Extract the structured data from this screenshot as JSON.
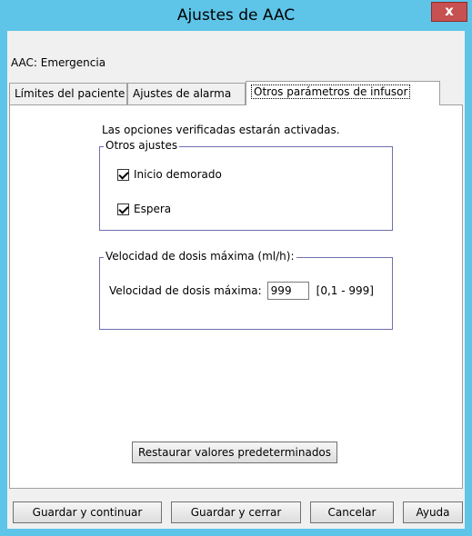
{
  "window": {
    "title": "Ajustes de AAC",
    "close_label": "x"
  },
  "context_label": "AAC: Emergencia",
  "tabs": [
    {
      "label": "Límites del paciente"
    },
    {
      "label": "Ajustes de alarma"
    },
    {
      "label": "Otros parámetros de infusor"
    }
  ],
  "active_tab_index": 2,
  "panel": {
    "note": "Las opciones verificadas estarán activadas.",
    "otros_ajustes": {
      "legend": "Otros ajustes",
      "options": [
        {
          "label": "Inicio demorado",
          "checked": true
        },
        {
          "label": "Espera",
          "checked": true
        }
      ]
    },
    "velocidad": {
      "legend": "Velocidad de dosis máxima (ml/h):",
      "field_label": "Velocidad de dosis máxima:",
      "value": "999",
      "range": "[0,1 - 999]"
    },
    "restore_button": "Restaurar valores predeterminados"
  },
  "footer": {
    "save_continue": "Guardar y continuar",
    "save_close": "Guardar y cerrar",
    "cancel": "Cancelar",
    "help": "Ayuda"
  },
  "colors": {
    "title_bar": "#5ec4e8",
    "close_button": "#c75050",
    "group_border": "#6e6eaf"
  }
}
